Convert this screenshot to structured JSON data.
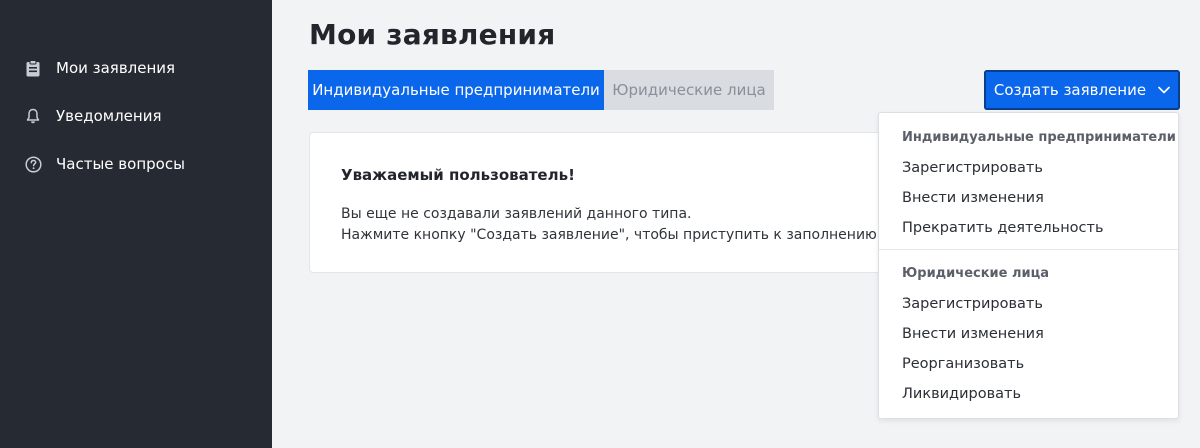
{
  "sidebar": {
    "items": [
      {
        "label": "Мои заявления",
        "icon": "clipboard-icon"
      },
      {
        "label": "Уведомления",
        "icon": "bell-icon"
      },
      {
        "label": "Частые вопросы",
        "icon": "question-circle-icon"
      }
    ]
  },
  "main": {
    "title": "Мои заявления",
    "tabs": [
      {
        "label": "Индивидуальные предприниматели",
        "active": true
      },
      {
        "label": "Юридические лица",
        "active": false
      }
    ],
    "create_button": {
      "label": "Создать заявление",
      "icon": "chevron-down-icon"
    },
    "empty_card": {
      "title": "Уважаемый пользователь!",
      "line1": "Вы еще не создавали заявлений данного типа.",
      "line2": "Нажмите кнопку \"Создать заявление\", чтобы приступить к заполнению нового заявления."
    }
  },
  "dropdown": {
    "sections": [
      {
        "header": "Индивидуальные предприниматели",
        "items": [
          "Зарегистрировать",
          "Внести изменения",
          "Прекратить деятельность"
        ]
      },
      {
        "header": "Юридические лица",
        "items": [
          "Зарегистрировать",
          "Внести изменения",
          "Реорганизовать",
          "Ликвидировать"
        ]
      }
    ]
  },
  "colors": {
    "sidebar_bg": "#262a33",
    "accent": "#0a66ea",
    "page_bg": "#f2f3f5"
  }
}
